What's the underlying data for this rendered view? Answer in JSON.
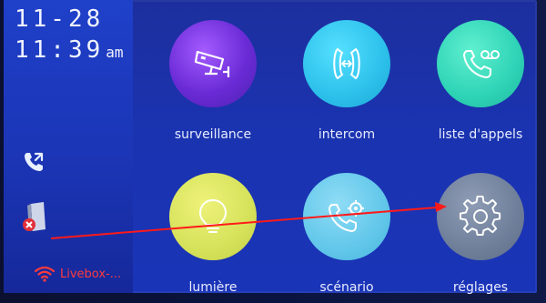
{
  "status": {
    "date": "11-28",
    "time": "11:39",
    "ampm": "am",
    "wifi_network": "Livebox-..."
  },
  "sidebar_icons": [
    "phone-callback-icon",
    "door-unit-offline-icon",
    "wifi-icon"
  ],
  "tiles": [
    {
      "id": "surveillance",
      "label": "surveillance",
      "icon": "cctv-camera-icon",
      "color": "#7b3be0"
    },
    {
      "id": "intercom",
      "label": "intercom",
      "icon": "intercom-handset-icon",
      "color": "#2dc3e8"
    },
    {
      "id": "call-list",
      "label": "liste d'appels",
      "icon": "voicemail-phone-icon",
      "color": "#2ed3b6"
    },
    {
      "id": "light",
      "label": "lumière",
      "icon": "light-bulb-icon",
      "color": "#d6e25a"
    },
    {
      "id": "scenario",
      "label": "scénario",
      "icon": "phone-settings-icon",
      "color": "#62c7ea"
    },
    {
      "id": "settings",
      "label": "réglages",
      "icon": "gear-icon",
      "color": "#6f7f9a"
    }
  ],
  "annotation": {
    "color": "#ff1a1a",
    "points_to": "réglages"
  }
}
